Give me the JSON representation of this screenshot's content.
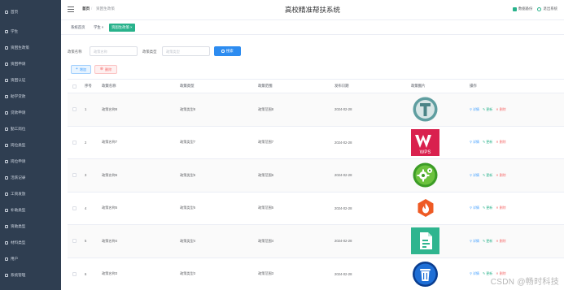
{
  "sidebar": {
    "items": [
      {
        "label": "首页",
        "icon": "home-icon"
      },
      {
        "label": "学生",
        "icon": "grid-icon"
      },
      {
        "label": "资困生政策",
        "icon": "grid-icon"
      },
      {
        "label": "资困申请",
        "icon": "grid-icon"
      },
      {
        "label": "资困认证",
        "icon": "grid-icon"
      },
      {
        "label": "助学贷款",
        "icon": "grid-icon"
      },
      {
        "label": "贷款申请",
        "icon": "grid-icon"
      },
      {
        "label": "勤工岗位",
        "icon": "grid-icon"
      },
      {
        "label": "岗位类型",
        "icon": "grid-icon"
      },
      {
        "label": "岗位申请",
        "icon": "grid-icon"
      },
      {
        "label": "活跃记录",
        "icon": "grid-icon"
      },
      {
        "label": "工资发放",
        "icon": "grid-icon"
      },
      {
        "label": "补助类型",
        "icon": "grid-icon"
      },
      {
        "label": "资助类型",
        "icon": "grid-icon"
      },
      {
        "label": "材料类型",
        "icon": "grid-icon"
      },
      {
        "label": "用户",
        "icon": "grid-icon"
      },
      {
        "label": "系统管理",
        "icon": "grid-icon"
      }
    ]
  },
  "header": {
    "breadcrumb_home": "首页",
    "breadcrumb_sep": "/",
    "breadcrumb_current": "资困生政策",
    "title": "高校精准帮扶系统",
    "backup_label": "数据备份",
    "logout_label": "退出系统"
  },
  "tags": [
    {
      "label": "系统首页",
      "active": false
    },
    {
      "label": "学生",
      "active": false,
      "closable": true
    },
    {
      "label": "资困生政策",
      "active": true,
      "closable": true
    }
  ],
  "search": {
    "name_label": "政策名称",
    "name_placeholder": "政策名称",
    "type_label": "政策类型",
    "type_placeholder": "政策类型",
    "button_label": "搜索"
  },
  "actions": {
    "add_label": "增加",
    "delete_label": "删除"
  },
  "table": {
    "columns": [
      "序号",
      "政策名称",
      "政策类型",
      "政策范围",
      "发布日期",
      "政策图片",
      "操作"
    ],
    "op_labels": {
      "info": "详情",
      "edit": "更新",
      "remove": "删除"
    },
    "rows": [
      {
        "index": "1",
        "name": "政策名称8",
        "type": "政策类型8",
        "scope": "政策范围8",
        "date": "2024-02-28",
        "image_icon": "typora-logo-icon"
      },
      {
        "index": "2",
        "name": "政策名称7",
        "type": "政策类型7",
        "scope": "政策范围7",
        "date": "2024-02-28",
        "image_icon": "wps-logo-icon"
      },
      {
        "index": "3",
        "name": "政策名称6",
        "type": "政策类型6",
        "scope": "政策范围6",
        "date": "2024-02-28",
        "image_icon": "gear-app-icon"
      },
      {
        "index": "4",
        "name": "政策名称5",
        "type": "政策类型5",
        "scope": "政策范围5",
        "date": "2024-02-28",
        "image_icon": "fire-app-icon"
      },
      {
        "index": "5",
        "name": "政策名称4",
        "type": "政策类型4",
        "scope": "政策范围4",
        "date": "2024-02-28",
        "image_icon": "document-app-icon"
      },
      {
        "index": "6",
        "name": "政策名称3",
        "type": "政策类型3",
        "scope": "政策范围3",
        "date": "2024-02-28",
        "image_icon": "trash-app-icon"
      }
    ]
  },
  "watermark": "CSDN @畅时科技",
  "colors": {
    "sidebar_bg": "#2f3e51",
    "accent_green": "#28b28b",
    "primary_blue": "#2d8cf0",
    "danger_red": "#f56c6c"
  }
}
